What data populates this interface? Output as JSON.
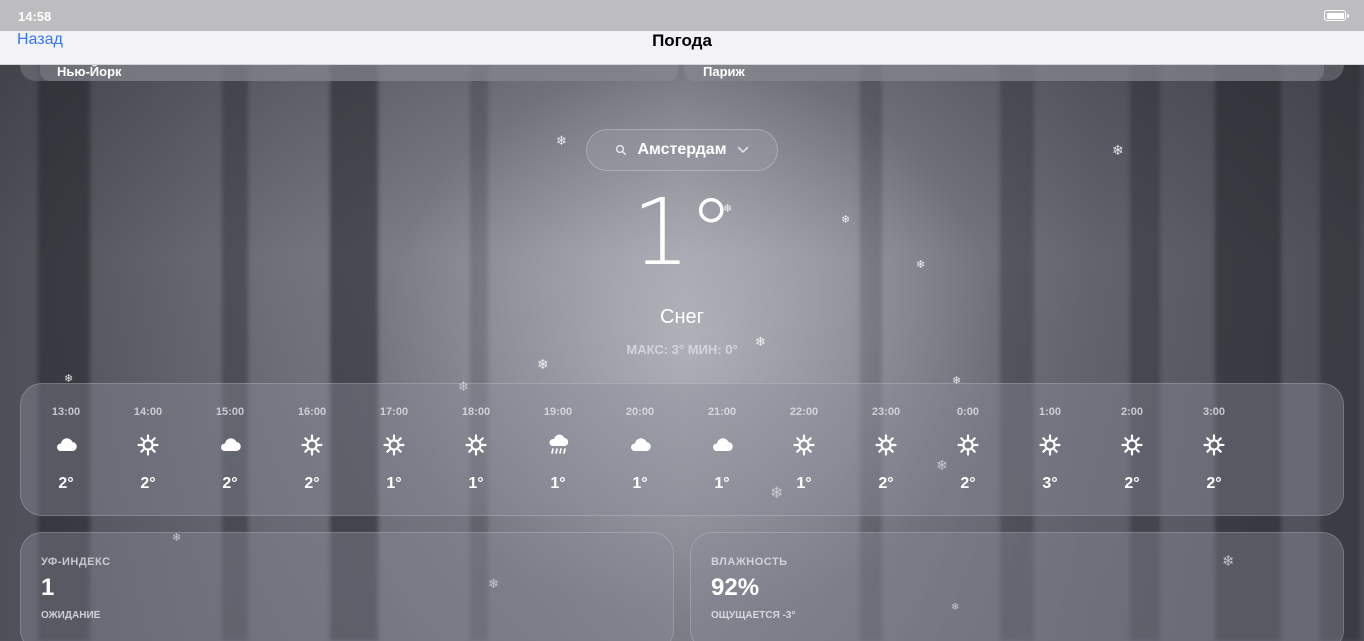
{
  "status_bar": {
    "time": "14:58"
  },
  "nav": {
    "back_label": "Назад",
    "title": "Погода"
  },
  "cities": [
    {
      "name": "Нью-Йорк"
    },
    {
      "name": "Париж"
    }
  ],
  "current": {
    "location": "Амстердам",
    "temperature": "1°",
    "condition": "Снег",
    "hi_lo": "МАКС: 3° МИН: 0°"
  },
  "hourly": [
    {
      "time": "13:00",
      "icon": "cloud-icon",
      "temp": "2°"
    },
    {
      "time": "14:00",
      "icon": "sun-icon",
      "temp": "2°"
    },
    {
      "time": "15:00",
      "icon": "cloud-icon",
      "temp": "2°"
    },
    {
      "time": "16:00",
      "icon": "sun-icon",
      "temp": "2°"
    },
    {
      "time": "17:00",
      "icon": "sun-icon",
      "temp": "1°"
    },
    {
      "time": "18:00",
      "icon": "sun-icon",
      "temp": "1°"
    },
    {
      "time": "19:00",
      "icon": "rain-cloud-icon",
      "temp": "1°"
    },
    {
      "time": "20:00",
      "icon": "cloud-icon",
      "temp": "1°"
    },
    {
      "time": "21:00",
      "icon": "cloud-icon",
      "temp": "1°"
    },
    {
      "time": "22:00",
      "icon": "sun-icon",
      "temp": "1°"
    },
    {
      "time": "23:00",
      "icon": "sun-icon",
      "temp": "2°"
    },
    {
      "time": "0:00",
      "icon": "sun-icon",
      "temp": "2°"
    },
    {
      "time": "1:00",
      "icon": "sun-icon",
      "temp": "3°"
    },
    {
      "time": "2:00",
      "icon": "sun-icon",
      "temp": "2°"
    },
    {
      "time": "3:00",
      "icon": "sun-icon",
      "temp": "2°"
    }
  ],
  "uv": {
    "label": "УФ-ИНДЕКС",
    "value": "1",
    "sub": "ОЖИДАНИЕ"
  },
  "humidity": {
    "label": "ВЛАЖНОСТЬ",
    "value": "92%",
    "sub": "ОЩУЩАЕТСЯ -3°"
  },
  "colors": {
    "accent_link": "#3478f6",
    "nav_bg": "#f2f2f7",
    "status_bg": "#bdbdbf"
  }
}
